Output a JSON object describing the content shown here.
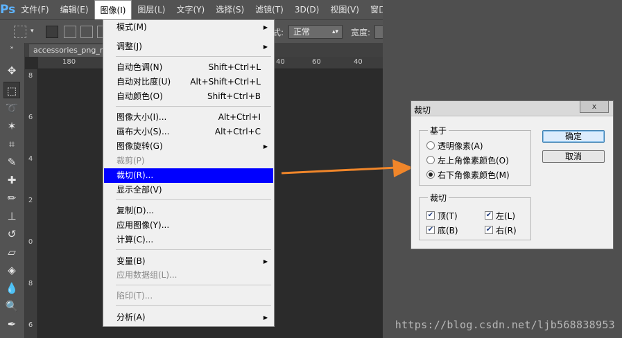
{
  "app": {
    "logo": "Ps"
  },
  "menubar": [
    {
      "id": "file",
      "label": "文件(F)"
    },
    {
      "id": "edit",
      "label": "编辑(E)"
    },
    {
      "id": "image",
      "label": "图像(I)"
    },
    {
      "id": "layer",
      "label": "图层(L)"
    },
    {
      "id": "type",
      "label": "文字(Y)"
    },
    {
      "id": "select",
      "label": "选择(S)"
    },
    {
      "id": "filter",
      "label": "滤镜(T)"
    },
    {
      "id": "3d",
      "label": "3D(D)"
    },
    {
      "id": "view",
      "label": "视图(V)"
    },
    {
      "id": "window",
      "label": "窗口"
    }
  ],
  "options": {
    "style_label": "式:",
    "style_value": "正常",
    "width_label": "宽度:"
  },
  "tabs": {
    "doc1": "accessories_png_re",
    "doc2": "*"
  },
  "ruler": {
    "h_ticks": [
      "180",
      "40",
      "60",
      "40"
    ],
    "v_ticks": [
      "8",
      "6",
      "4",
      "2",
      "0",
      "8",
      "6"
    ]
  },
  "image_menu": {
    "items": [
      {
        "label": "模式(M)",
        "shortcut": "",
        "submenu": true,
        "disabled": false
      },
      {
        "label": "调整(J)",
        "shortcut": "",
        "submenu": true,
        "disabled": false
      },
      {
        "label": "自动色调(N)",
        "shortcut": "Shift+Ctrl+L",
        "submenu": false,
        "disabled": false
      },
      {
        "label": "自动对比度(U)",
        "shortcut": "Alt+Shift+Ctrl+L",
        "submenu": false,
        "disabled": false
      },
      {
        "label": "自动颜色(O)",
        "shortcut": "Shift+Ctrl+B",
        "submenu": false,
        "disabled": false
      },
      {
        "label": "图像大小(I)...",
        "shortcut": "Alt+Ctrl+I",
        "submenu": false,
        "disabled": false
      },
      {
        "label": "画布大小(S)...",
        "shortcut": "Alt+Ctrl+C",
        "submenu": false,
        "disabled": false
      },
      {
        "label": "图像旋转(G)",
        "shortcut": "",
        "submenu": true,
        "disabled": false
      },
      {
        "label": "裁剪(P)",
        "shortcut": "",
        "submenu": false,
        "disabled": true
      },
      {
        "label": "裁切(R)...",
        "shortcut": "",
        "submenu": false,
        "disabled": false,
        "highlighted": true
      },
      {
        "label": "显示全部(V)",
        "shortcut": "",
        "submenu": false,
        "disabled": false
      },
      {
        "label": "复制(D)...",
        "shortcut": "",
        "submenu": false,
        "disabled": false
      },
      {
        "label": "应用图像(Y)...",
        "shortcut": "",
        "submenu": false,
        "disabled": false
      },
      {
        "label": "计算(C)...",
        "shortcut": "",
        "submenu": false,
        "disabled": false
      },
      {
        "label": "变量(B)",
        "shortcut": "",
        "submenu": true,
        "disabled": false
      },
      {
        "label": "应用数据组(L)...",
        "shortcut": "",
        "submenu": false,
        "disabled": true
      },
      {
        "label": "陷印(T)...",
        "shortcut": "",
        "submenu": false,
        "disabled": true
      },
      {
        "label": "分析(A)",
        "shortcut": "",
        "submenu": true,
        "disabled": false
      }
    ]
  },
  "trim_dialog": {
    "title": "裁切",
    "close_label": "x",
    "based_on": {
      "legend": "基于",
      "options": [
        "透明像素(A)",
        "左上角像素颜色(O)",
        "右下角像素颜色(M)"
      ],
      "selected_index": 2
    },
    "trim_away": {
      "legend": "裁切",
      "top": "顶(T)",
      "left": "左(L)",
      "bottom": "底(B)",
      "right": "右(R)",
      "top_checked": true,
      "left_checked": true,
      "bottom_checked": true,
      "right_checked": true
    },
    "ok_label": "确定",
    "cancel_label": "取消"
  },
  "colors": {
    "highlight": "#0000ff",
    "arrow": "#f0862a"
  },
  "watermark": "https://blog.csdn.net/ljb568838953"
}
